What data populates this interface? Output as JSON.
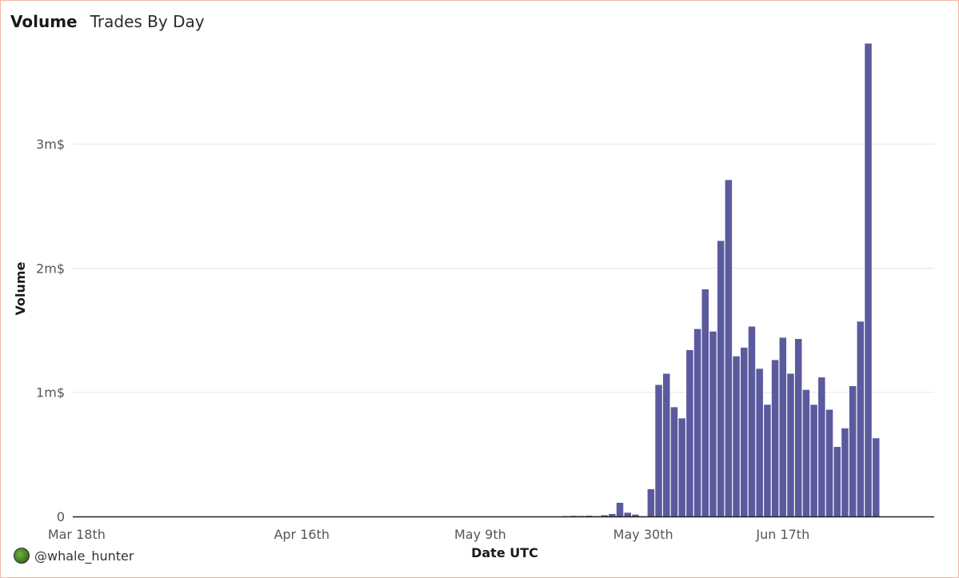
{
  "header": {
    "title": "Volume",
    "subtitle": "Trades By Day"
  },
  "footer": {
    "handle": "@whale_hunter",
    "avatar_icon": "whale-avatar-icon"
  },
  "colors": {
    "bar": "#5b5a9e",
    "grid": "#e6e6e6",
    "axis": "#222222"
  },
  "chart_data": {
    "type": "bar",
    "xlabel": "Date UTC",
    "ylabel": "Volume",
    "ylim": [
      0,
      3800000
    ],
    "yticks": [
      {
        "value": 0,
        "label": "0"
      },
      {
        "value": 1000000,
        "label": "1m$"
      },
      {
        "value": 2000000,
        "label": "2m$"
      },
      {
        "value": 3000000,
        "label": "3m$"
      }
    ],
    "x_range": [
      "2022-03-18",
      "2022-07-07"
    ],
    "xticks": [
      {
        "date": "2022-03-18",
        "label": "Mar 18th"
      },
      {
        "date": "2022-04-16",
        "label": "Apr 16th"
      },
      {
        "date": "2022-05-09",
        "label": "May 9th"
      },
      {
        "date": "2022-05-30",
        "label": "May 30th"
      },
      {
        "date": "2022-06-17",
        "label": "Jun 17th"
      }
    ],
    "grid": true,
    "legend": "none",
    "series": [
      {
        "dates": [
          "2022-05-20",
          "2022-05-21",
          "2022-05-22",
          "2022-05-23",
          "2022-05-24",
          "2022-05-25",
          "2022-05-26",
          "2022-05-27",
          "2022-05-28",
          "2022-05-29",
          "2022-05-30",
          "2022-05-31",
          "2022-06-01",
          "2022-06-02",
          "2022-06-03",
          "2022-06-04",
          "2022-06-05",
          "2022-06-06",
          "2022-06-07",
          "2022-06-08",
          "2022-06-09",
          "2022-06-10",
          "2022-06-11",
          "2022-06-12",
          "2022-06-13",
          "2022-06-14",
          "2022-06-15",
          "2022-06-16",
          "2022-06-17",
          "2022-06-18",
          "2022-06-19",
          "2022-06-20",
          "2022-06-21",
          "2022-06-22",
          "2022-06-23",
          "2022-06-24",
          "2022-06-25",
          "2022-06-26",
          "2022-06-27",
          "2022-06-28",
          "2022-06-29",
          "2022-06-30",
          "2022-07-01",
          "2022-07-02",
          "2022-07-03",
          "2022-07-04",
          "2022-07-05",
          "2022-07-06"
        ],
        "values": [
          3000,
          5000,
          4000,
          6000,
          3000,
          10000,
          20000,
          110000,
          30000,
          15000,
          2000,
          220000,
          1060000,
          1150000,
          880000,
          790000,
          1340000,
          1510000,
          1830000,
          1490000,
          2220000,
          2710000,
          1290000,
          1360000,
          1530000,
          1190000,
          900000,
          1260000,
          1440000,
          1150000,
          1430000,
          1020000,
          900000,
          1120000,
          860000,
          560000,
          710000,
          1050000,
          1570000,
          3810000,
          630000,
          0
        ]
      }
    ]
  }
}
